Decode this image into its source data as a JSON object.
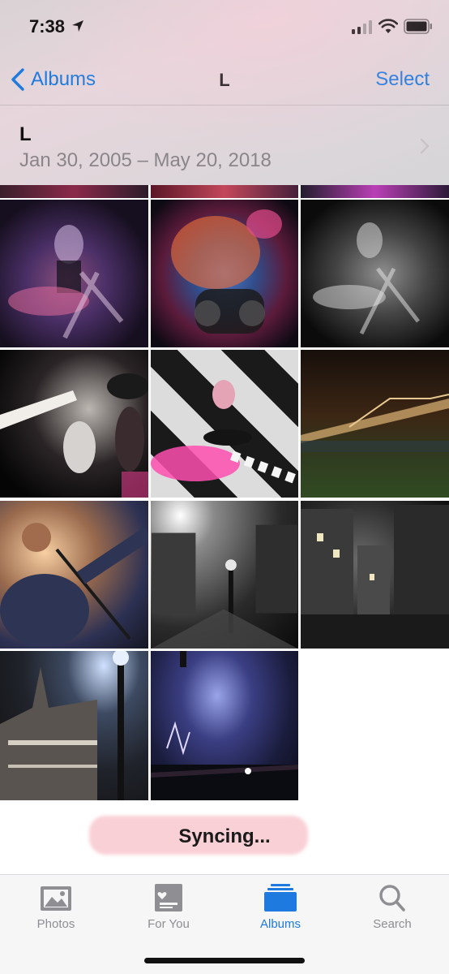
{
  "status_bar": {
    "time": "7:38",
    "icons": [
      "location-arrow-icon",
      "cellular-signal-icon",
      "wifi-icon",
      "battery-icon"
    ]
  },
  "nav": {
    "back_label": "Albums",
    "title": "L",
    "select_label": "Select"
  },
  "album_summary": {
    "letter": "L",
    "date_range": "Jan 30, 2005 – May 20, 2018"
  },
  "grid": {
    "photo_count_visible": 14
  },
  "sync": {
    "label": "Syncing..."
  },
  "tabbar": {
    "tabs": [
      {
        "label": "Photos",
        "icon": "photos-icon",
        "active": false
      },
      {
        "label": "For You",
        "icon": "for-you-icon",
        "active": false
      },
      {
        "label": "Albums",
        "icon": "albums-icon",
        "active": true
      },
      {
        "label": "Search",
        "icon": "search-icon",
        "active": false
      }
    ]
  },
  "colors": {
    "accent": "#1f7ae0",
    "inactive_tab": "#8e8e93",
    "secondary_text": "#8a8588"
  }
}
